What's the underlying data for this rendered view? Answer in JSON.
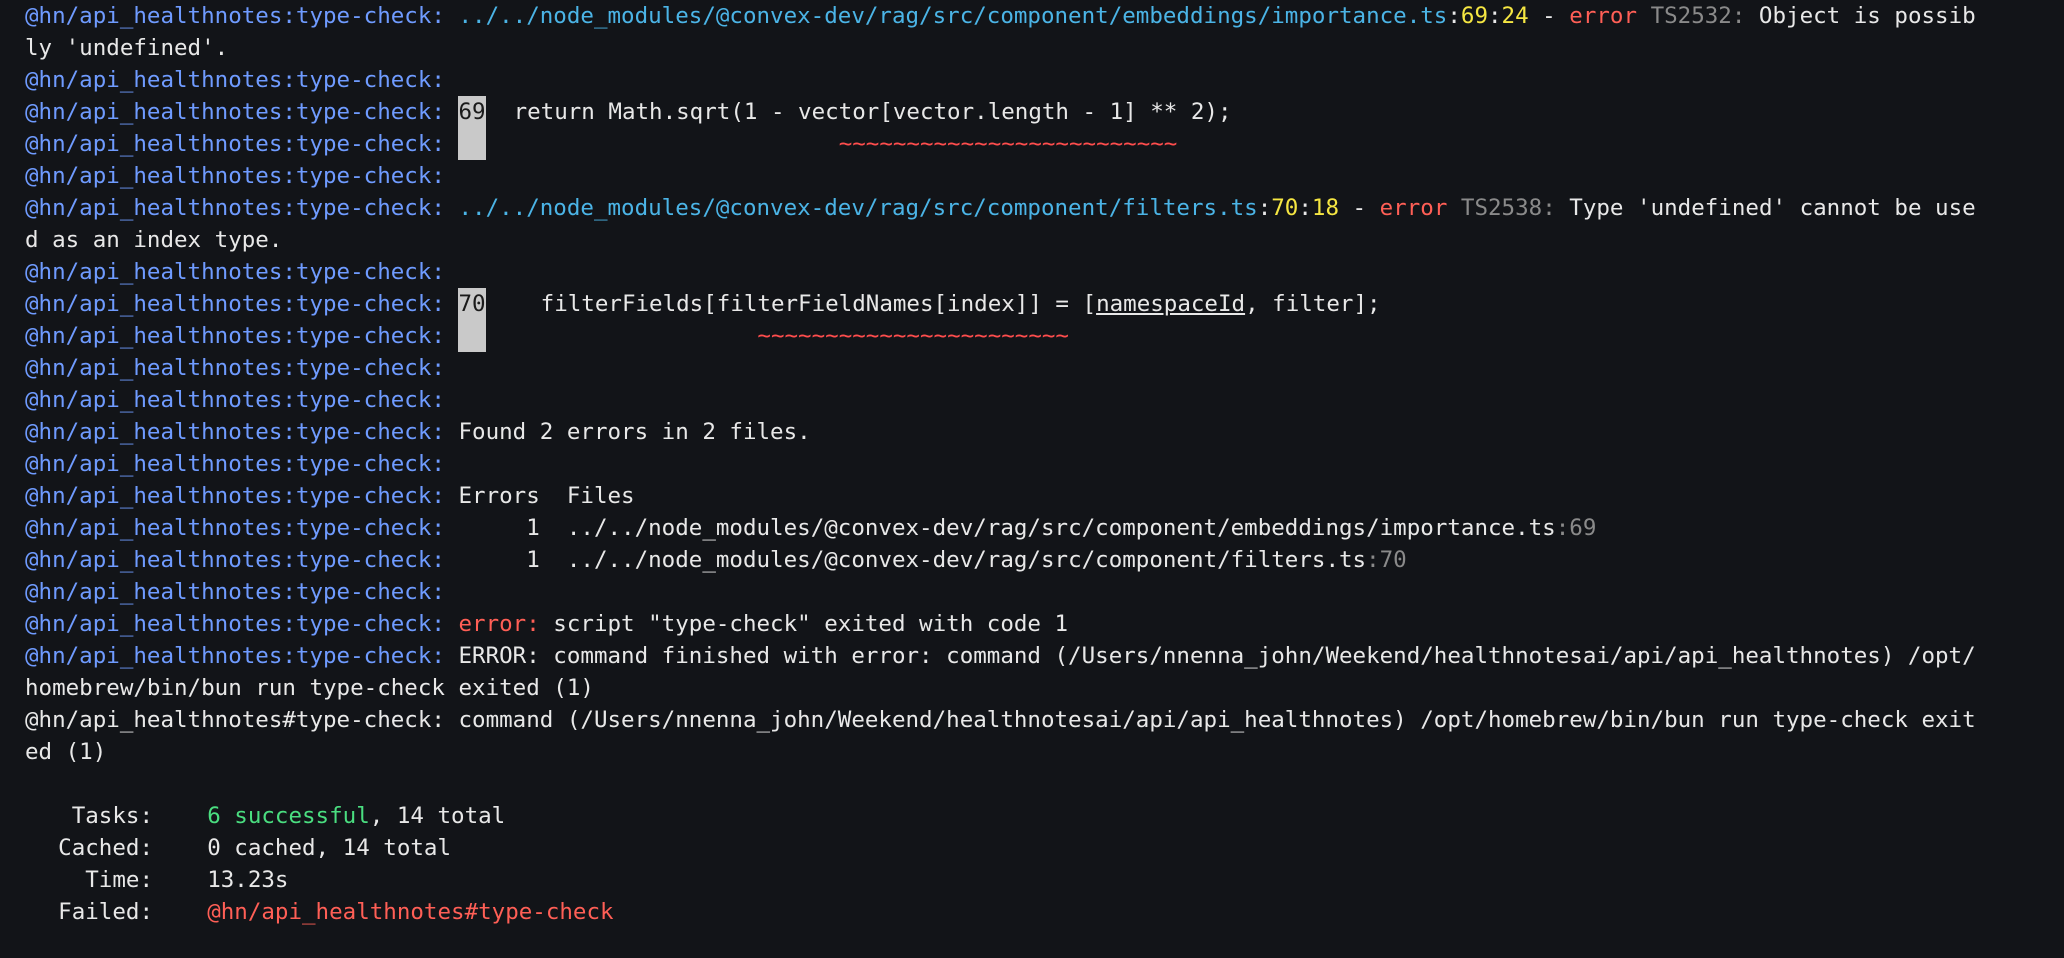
{
  "terminal": {
    "prefix": "@hn/api_healthnotes:type-check: ",
    "prefix_hash": "@hn/api_healthnotes#type-check: ",
    "error1": {
      "path": "../../node_modules/@convex-dev/rag/src/component/embeddings/importance.ts",
      "line": "69",
      "col": "24",
      "sep": " - ",
      "word": "error",
      "code": "TS2532:",
      "msg_a": " Object is possib",
      "msg_b": "ly 'undefined'.",
      "gutter": "69",
      "code_line": "  return Math.sqrt(1 - vector[vector.length - 1] ** 2);",
      "tildes": "~~~~~~~~~~~~~~~~~~~~~~~~~"
    },
    "error2": {
      "path": "../../node_modules/@convex-dev/rag/src/component/filters.ts",
      "line": "70",
      "col": "18",
      "sep": " - ",
      "word": "error",
      "code": "TS2538:",
      "msg_a": " Type 'undefined' cannot be use",
      "msg_b": "d as an index type.",
      "gutter": "70",
      "code_a": "    filterFields[filterFieldNames[index]] = [",
      "code_ul": "namespaceId",
      "code_b": ", filter];",
      "tildes": "~~~~~~~~~~~~~~~~~~~~~~~"
    },
    "found": "Found 2 errors in 2 files.",
    "table_header": "Errors  Files",
    "rows": [
      {
        "count": "     1  ",
        "file": "../../node_modules/@convex-dev/rag/src/component/embeddings/importance.ts",
        "loc": ":69"
      },
      {
        "count": "     1  ",
        "file": "../../node_modules/@convex-dev/rag/src/component/filters.ts",
        "loc": ":70"
      }
    ],
    "script_error_word": "error:",
    "script_error_msg": " script \"type-check\" exited with code 1",
    "cmd_error_a": "ERROR: command finished with error: command (/Users/nnenna_john/Weekend/healthnotesai/api/api_healthnotes) /opt/",
    "cmd_error_b": "homebrew/bin/bun run type-check exited (1)",
    "final_cmd_a": "command (/Users/nnenna_john/Weekend/healthnotesai/api/api_healthnotes) /opt/homebrew/bin/bun run type-check exit",
    "final_cmd_b": "ed (1)"
  },
  "summary": {
    "tasks_label": "Tasks:",
    "tasks_success": "6 successful",
    "tasks_total": ", 14 total",
    "cached_label": "Cached:",
    "cached_value": "0 cached, 14 total",
    "time_label": "Time:",
    "time_value": "13.23s",
    "failed_label": "Failed:",
    "failed_value": "@hn/api_healthnotes#type-check"
  },
  "colors": {
    "background": "#121418",
    "prefix": "#6f9bff",
    "path": "#4bb4e6",
    "line_col": "#f5e642",
    "error": "#ff5f56",
    "code": "#8a8a8a",
    "success": "#4ade80"
  }
}
